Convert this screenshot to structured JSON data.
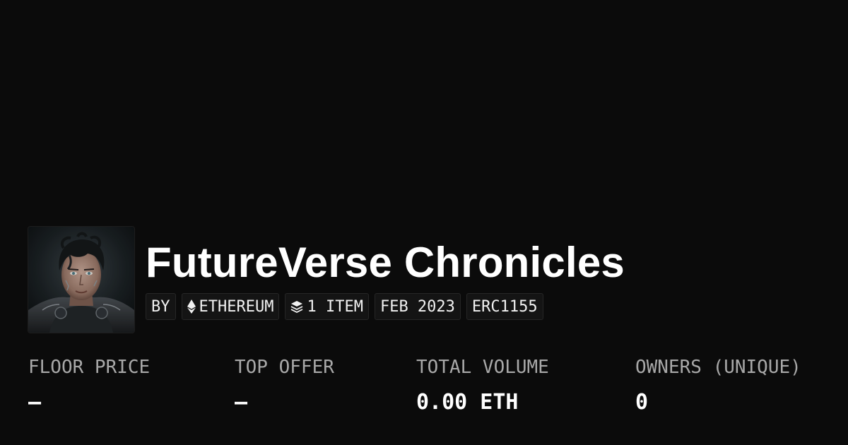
{
  "collection": {
    "name": "FutureVerse Chronicles",
    "avatar_alt": "collection-avatar"
  },
  "badges": {
    "by": "BY",
    "chain": {
      "label": "ETHEREUM",
      "icon": "ethereum-icon"
    },
    "items": {
      "label": "1 ITEM",
      "icon": "layers-icon"
    },
    "date": "FEB 2023",
    "standard": "ERC1155"
  },
  "stats": {
    "floor_price": {
      "label": "FLOOR PRICE",
      "value": "–"
    },
    "top_offer": {
      "label": "TOP OFFER",
      "value": "–"
    },
    "total_volume": {
      "label": "TOTAL VOLUME",
      "value": "0.00 ETH"
    },
    "owners": {
      "label": "OWNERS (UNIQUE)",
      "value": "0"
    }
  },
  "colors": {
    "background": "#0b0b0b",
    "text_primary": "#ffffff",
    "text_muted": "#a8a8a8",
    "badge_bg": "#141414",
    "badge_border": "#262626"
  }
}
